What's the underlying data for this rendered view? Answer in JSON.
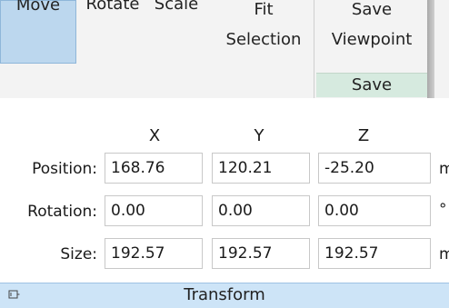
{
  "ribbon": {
    "move": "Move",
    "rotate": "Rotate",
    "scale": "Scale",
    "fit_line1": "Fit",
    "fit_line2": "Selection",
    "save_viewpoint_line1": "Save",
    "save_viewpoint_line2": "Viewpoint",
    "save_group_label": "Save"
  },
  "transform": {
    "axes": [
      "X",
      "Y",
      "Z"
    ],
    "rows": [
      {
        "label": "Position:",
        "values": [
          "168.76",
          "120.21",
          "-25.20"
        ],
        "unit": "m"
      },
      {
        "label": "Rotation:",
        "values": [
          "0.00",
          "0.00",
          "0.00"
        ],
        "unit": "°"
      },
      {
        "label": "Size:",
        "values": [
          "192.57",
          "192.57",
          "192.57"
        ],
        "unit": "m"
      }
    ]
  },
  "panel": {
    "title": "Transform",
    "icon": "pin-icon"
  },
  "colors": {
    "selected_button": "#bcd7ee",
    "save_group": "#d6eadf",
    "panel_bar": "#cde4f7"
  }
}
